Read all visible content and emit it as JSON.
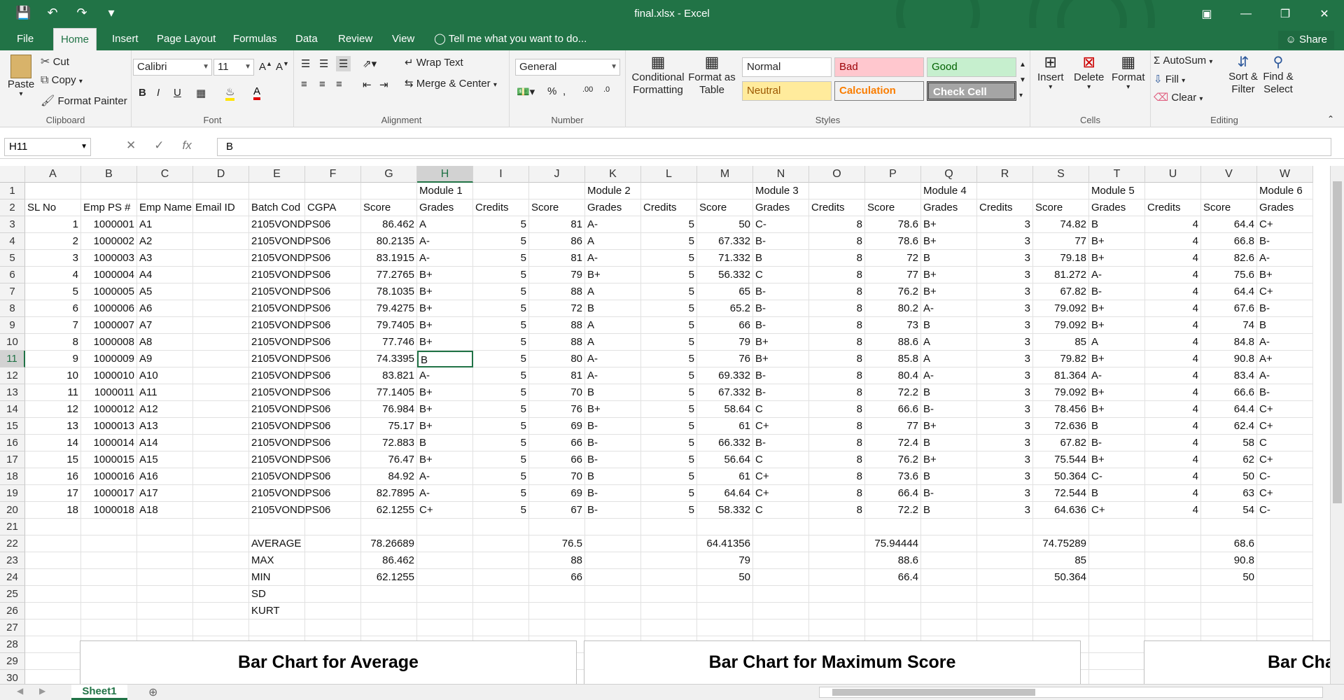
{
  "app": {
    "title": "final.xlsx - Excel",
    "tabs": [
      "File",
      "Home",
      "Insert",
      "Page Layout",
      "Formulas",
      "Data",
      "Review",
      "View"
    ],
    "active_tab": "Home",
    "tell_me": "Tell me what you want to do...",
    "share": "Share"
  },
  "ribbon": {
    "clipboard": {
      "paste": "Paste",
      "cut": "Cut",
      "copy": "Copy",
      "format_painter": "Format Painter",
      "label": "Clipboard"
    },
    "font": {
      "name": "Calibri",
      "size": "11",
      "label": "Font"
    },
    "alignment": {
      "wrap": "Wrap Text",
      "merge": "Merge & Center",
      "label": "Alignment"
    },
    "number": {
      "format": "General",
      "label": "Number"
    },
    "styles": {
      "conditional": "Conditional Formatting",
      "format_table": "Format as Table",
      "normal": "Normal",
      "bad": "Bad",
      "good": "Good",
      "neutral": "Neutral",
      "calculation": "Calculation",
      "check": "Check Cell",
      "label": "Styles"
    },
    "cells": {
      "insert": "Insert",
      "delete": "Delete",
      "format": "Format",
      "label": "Cells"
    },
    "editing": {
      "autosum": "AutoSum",
      "fill": "Fill",
      "clear": "Clear",
      "sort": "Sort & Filter",
      "find": "Find & Select",
      "label": "Editing"
    }
  },
  "formula_bar": {
    "name_box": "H11",
    "content": "B"
  },
  "grid": {
    "columns": [
      "A",
      "B",
      "C",
      "D",
      "E",
      "F",
      "G",
      "H",
      "I",
      "J",
      "K",
      "L",
      "M",
      "N",
      "O",
      "P",
      "Q",
      "R",
      "S",
      "T",
      "U",
      "V",
      "W"
    ],
    "selected_column": "H",
    "selected_row": "11",
    "row_numbers": [
      "1",
      "2",
      "3",
      "4",
      "5",
      "6",
      "7",
      "8",
      "9",
      "10",
      "11",
      "12",
      "13",
      "14",
      "15",
      "16",
      "17",
      "18",
      "19",
      "20",
      "21",
      "22",
      "23",
      "24",
      "25",
      "26",
      "27",
      "28",
      "29",
      "30"
    ],
    "rows": [
      [
        "",
        "",
        "",
        "",
        "",
        "",
        "",
        "Module 1",
        "",
        "",
        "Module 2",
        "",
        "",
        "Module 3",
        "",
        "",
        "Module 4",
        "",
        "",
        "Module 5",
        "",
        "",
        "Module 6"
      ],
      [
        "SL No",
        "Emp PS #",
        "Emp Name",
        "Email ID",
        "Batch Cod",
        "CGPA",
        "Score",
        "Grades",
        "Credits",
        "Score",
        "Grades",
        "Credits",
        "Score",
        "Grades",
        "Credits",
        "Score",
        "Grades",
        "Credits",
        "Score",
        "Grades",
        "Credits",
        "Score",
        "Grades"
      ],
      [
        "1",
        "1000001",
        "A1",
        "",
        "2105VONDPS06",
        "",
        "86.462",
        "A",
        "5",
        "81",
        "A-",
        "5",
        "50",
        "C-",
        "8",
        "78.6",
        "B+",
        "3",
        "74.82",
        "B",
        "4",
        "64.4",
        "C+"
      ],
      [
        "2",
        "1000002",
        "A2",
        "",
        "2105VONDPS06",
        "",
        "80.2135",
        "A-",
        "5",
        "86",
        "A",
        "5",
        "67.332",
        "B-",
        "8",
        "78.6",
        "B+",
        "3",
        "77",
        "B+",
        "4",
        "66.8",
        "B-"
      ],
      [
        "3",
        "1000003",
        "A3",
        "",
        "2105VONDPS06",
        "",
        "83.1915",
        "A-",
        "5",
        "81",
        "A-",
        "5",
        "71.332",
        "B",
        "8",
        "72",
        "B",
        "3",
        "79.18",
        "B+",
        "4",
        "82.6",
        "A-"
      ],
      [
        "4",
        "1000004",
        "A4",
        "",
        "2105VONDPS06",
        "",
        "77.2765",
        "B+",
        "5",
        "79",
        "B+",
        "5",
        "56.332",
        "C",
        "8",
        "77",
        "B+",
        "3",
        "81.272",
        "A-",
        "4",
        "75.6",
        "B+"
      ],
      [
        "5",
        "1000005",
        "A5",
        "",
        "2105VONDPS06",
        "",
        "78.1035",
        "B+",
        "5",
        "88",
        "A",
        "5",
        "65",
        "B-",
        "8",
        "76.2",
        "B+",
        "3",
        "67.82",
        "B-",
        "4",
        "64.4",
        "C+"
      ],
      [
        "6",
        "1000006",
        "A6",
        "",
        "2105VONDPS06",
        "",
        "79.4275",
        "B+",
        "5",
        "72",
        "B",
        "5",
        "65.2",
        "B-",
        "8",
        "80.2",
        "A-",
        "3",
        "79.092",
        "B+",
        "4",
        "67.6",
        "B-"
      ],
      [
        "7",
        "1000007",
        "A7",
        "",
        "2105VONDPS06",
        "",
        "79.7405",
        "B+",
        "5",
        "88",
        "A",
        "5",
        "66",
        "B-",
        "8",
        "73",
        "B",
        "3",
        "79.092",
        "B+",
        "4",
        "74",
        "B"
      ],
      [
        "8",
        "1000008",
        "A8",
        "",
        "2105VONDPS06",
        "",
        "77.746",
        "B+",
        "5",
        "88",
        "A",
        "5",
        "79",
        "B+",
        "8",
        "88.6",
        "A",
        "3",
        "85",
        "A",
        "4",
        "84.8",
        "A-"
      ],
      [
        "9",
        "1000009",
        "A9",
        "",
        "2105VONDPS06",
        "",
        "74.3395",
        "B",
        "5",
        "80",
        "A-",
        "5",
        "76",
        "B+",
        "8",
        "85.8",
        "A",
        "3",
        "79.82",
        "B+",
        "4",
        "90.8",
        "A+"
      ],
      [
        "10",
        "1000010",
        "A10",
        "",
        "2105VONDPS06",
        "",
        "83.821",
        "A-",
        "5",
        "81",
        "A-",
        "5",
        "69.332",
        "B-",
        "8",
        "80.4",
        "A-",
        "3",
        "81.364",
        "A-",
        "4",
        "83.4",
        "A-"
      ],
      [
        "11",
        "1000011",
        "A11",
        "",
        "2105VONDPS06",
        "",
        "77.1405",
        "B+",
        "5",
        "70",
        "B",
        "5",
        "67.332",
        "B-",
        "8",
        "72.2",
        "B",
        "3",
        "79.092",
        "B+",
        "4",
        "66.6",
        "B-"
      ],
      [
        "12",
        "1000012",
        "A12",
        "",
        "2105VONDPS06",
        "",
        "76.984",
        "B+",
        "5",
        "76",
        "B+",
        "5",
        "58.64",
        "C",
        "8",
        "66.6",
        "B-",
        "3",
        "78.456",
        "B+",
        "4",
        "64.4",
        "C+"
      ],
      [
        "13",
        "1000013",
        "A13",
        "",
        "2105VONDPS06",
        "",
        "75.17",
        "B+",
        "5",
        "69",
        "B-",
        "5",
        "61",
        "C+",
        "8",
        "77",
        "B+",
        "3",
        "72.636",
        "B",
        "4",
        "62.4",
        "C+"
      ],
      [
        "14",
        "1000014",
        "A14",
        "",
        "2105VONDPS06",
        "",
        "72.883",
        "B",
        "5",
        "66",
        "B-",
        "5",
        "66.332",
        "B-",
        "8",
        "72.4",
        "B",
        "3",
        "67.82",
        "B-",
        "4",
        "58",
        "C"
      ],
      [
        "15",
        "1000015",
        "A15",
        "",
        "2105VONDPS06",
        "",
        "76.47",
        "B+",
        "5",
        "66",
        "B-",
        "5",
        "56.64",
        "C",
        "8",
        "76.2",
        "B+",
        "3",
        "75.544",
        "B+",
        "4",
        "62",
        "C+"
      ],
      [
        "16",
        "1000016",
        "A16",
        "",
        "2105VONDPS06",
        "",
        "84.92",
        "A-",
        "5",
        "70",
        "B",
        "5",
        "61",
        "C+",
        "8",
        "73.6",
        "B",
        "3",
        "50.364",
        "C-",
        "4",
        "50",
        "C-"
      ],
      [
        "17",
        "1000017",
        "A17",
        "",
        "2105VONDPS06",
        "",
        "82.7895",
        "A-",
        "5",
        "69",
        "B-",
        "5",
        "64.64",
        "C+",
        "8",
        "66.4",
        "B-",
        "3",
        "72.544",
        "B",
        "4",
        "63",
        "C+"
      ],
      [
        "18",
        "1000018",
        "A18",
        "",
        "2105VONDPS06",
        "",
        "62.1255",
        "C+",
        "5",
        "67",
        "B-",
        "5",
        "58.332",
        "C",
        "8",
        "72.2",
        "B",
        "3",
        "64.636",
        "C+",
        "4",
        "54",
        "C-"
      ],
      [],
      [
        "",
        "",
        "",
        "",
        "AVERAGE",
        "",
        "78.26689",
        "",
        "",
        "76.5",
        "",
        "",
        "64.41356",
        "",
        "",
        "75.94444",
        "",
        "",
        "74.75289",
        "",
        "",
        "68.6",
        ""
      ],
      [
        "",
        "",
        "",
        "",
        "MAX",
        "",
        "86.462",
        "",
        "",
        "88",
        "",
        "",
        "79",
        "",
        "",
        "88.6",
        "",
        "",
        "85",
        "",
        "",
        "90.8",
        ""
      ],
      [
        "",
        "",
        "",
        "",
        "MIN",
        "",
        "62.1255",
        "",
        "",
        "66",
        "",
        "",
        "50",
        "",
        "",
        "66.4",
        "",
        "",
        "50.364",
        "",
        "",
        "50",
        ""
      ],
      [
        "",
        "",
        "",
        "",
        "SD"
      ],
      [
        "",
        "",
        "",
        "",
        "KURT"
      ]
    ]
  },
  "charts": [
    {
      "title": "Bar Chart for Average"
    },
    {
      "title": "Bar Chart for Maximum Score"
    },
    {
      "title": "Bar Chart"
    }
  ],
  "status": {
    "sheet": "Sheet1"
  }
}
